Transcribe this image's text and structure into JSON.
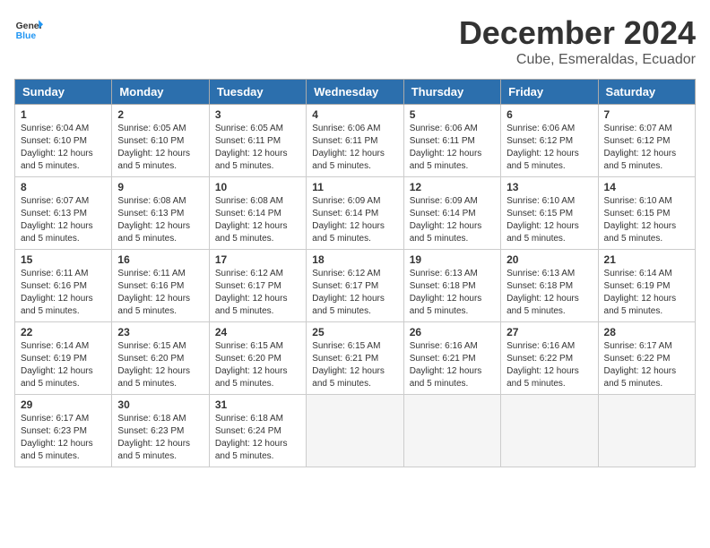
{
  "header": {
    "logo_general": "General",
    "logo_blue": "Blue",
    "month_title": "December 2024",
    "location": "Cube, Esmeraldas, Ecuador"
  },
  "weekdays": [
    "Sunday",
    "Monday",
    "Tuesday",
    "Wednesday",
    "Thursday",
    "Friday",
    "Saturday"
  ],
  "weeks": [
    [
      {
        "day": "1",
        "sunrise": "6:04 AM",
        "sunset": "6:10 PM",
        "daylight": "12 hours and 5 minutes."
      },
      {
        "day": "2",
        "sunrise": "6:05 AM",
        "sunset": "6:10 PM",
        "daylight": "12 hours and 5 minutes."
      },
      {
        "day": "3",
        "sunrise": "6:05 AM",
        "sunset": "6:11 PM",
        "daylight": "12 hours and 5 minutes."
      },
      {
        "day": "4",
        "sunrise": "6:06 AM",
        "sunset": "6:11 PM",
        "daylight": "12 hours and 5 minutes."
      },
      {
        "day": "5",
        "sunrise": "6:06 AM",
        "sunset": "6:11 PM",
        "daylight": "12 hours and 5 minutes."
      },
      {
        "day": "6",
        "sunrise": "6:06 AM",
        "sunset": "6:12 PM",
        "daylight": "12 hours and 5 minutes."
      },
      {
        "day": "7",
        "sunrise": "6:07 AM",
        "sunset": "6:12 PM",
        "daylight": "12 hours and 5 minutes."
      }
    ],
    [
      {
        "day": "8",
        "sunrise": "6:07 AM",
        "sunset": "6:13 PM",
        "daylight": "12 hours and 5 minutes."
      },
      {
        "day": "9",
        "sunrise": "6:08 AM",
        "sunset": "6:13 PM",
        "daylight": "12 hours and 5 minutes."
      },
      {
        "day": "10",
        "sunrise": "6:08 AM",
        "sunset": "6:14 PM",
        "daylight": "12 hours and 5 minutes."
      },
      {
        "day": "11",
        "sunrise": "6:09 AM",
        "sunset": "6:14 PM",
        "daylight": "12 hours and 5 minutes."
      },
      {
        "day": "12",
        "sunrise": "6:09 AM",
        "sunset": "6:14 PM",
        "daylight": "12 hours and 5 minutes."
      },
      {
        "day": "13",
        "sunrise": "6:10 AM",
        "sunset": "6:15 PM",
        "daylight": "12 hours and 5 minutes."
      },
      {
        "day": "14",
        "sunrise": "6:10 AM",
        "sunset": "6:15 PM",
        "daylight": "12 hours and 5 minutes."
      }
    ],
    [
      {
        "day": "15",
        "sunrise": "6:11 AM",
        "sunset": "6:16 PM",
        "daylight": "12 hours and 5 minutes."
      },
      {
        "day": "16",
        "sunrise": "6:11 AM",
        "sunset": "6:16 PM",
        "daylight": "12 hours and 5 minutes."
      },
      {
        "day": "17",
        "sunrise": "6:12 AM",
        "sunset": "6:17 PM",
        "daylight": "12 hours and 5 minutes."
      },
      {
        "day": "18",
        "sunrise": "6:12 AM",
        "sunset": "6:17 PM",
        "daylight": "12 hours and 5 minutes."
      },
      {
        "day": "19",
        "sunrise": "6:13 AM",
        "sunset": "6:18 PM",
        "daylight": "12 hours and 5 minutes."
      },
      {
        "day": "20",
        "sunrise": "6:13 AM",
        "sunset": "6:18 PM",
        "daylight": "12 hours and 5 minutes."
      },
      {
        "day": "21",
        "sunrise": "6:14 AM",
        "sunset": "6:19 PM",
        "daylight": "12 hours and 5 minutes."
      }
    ],
    [
      {
        "day": "22",
        "sunrise": "6:14 AM",
        "sunset": "6:19 PM",
        "daylight": "12 hours and 5 minutes."
      },
      {
        "day": "23",
        "sunrise": "6:15 AM",
        "sunset": "6:20 PM",
        "daylight": "12 hours and 5 minutes."
      },
      {
        "day": "24",
        "sunrise": "6:15 AM",
        "sunset": "6:20 PM",
        "daylight": "12 hours and 5 minutes."
      },
      {
        "day": "25",
        "sunrise": "6:15 AM",
        "sunset": "6:21 PM",
        "daylight": "12 hours and 5 minutes."
      },
      {
        "day": "26",
        "sunrise": "6:16 AM",
        "sunset": "6:21 PM",
        "daylight": "12 hours and 5 minutes."
      },
      {
        "day": "27",
        "sunrise": "6:16 AM",
        "sunset": "6:22 PM",
        "daylight": "12 hours and 5 minutes."
      },
      {
        "day": "28",
        "sunrise": "6:17 AM",
        "sunset": "6:22 PM",
        "daylight": "12 hours and 5 minutes."
      }
    ],
    [
      {
        "day": "29",
        "sunrise": "6:17 AM",
        "sunset": "6:23 PM",
        "daylight": "12 hours and 5 minutes."
      },
      {
        "day": "30",
        "sunrise": "6:18 AM",
        "sunset": "6:23 PM",
        "daylight": "12 hours and 5 minutes."
      },
      {
        "day": "31",
        "sunrise": "6:18 AM",
        "sunset": "6:24 PM",
        "daylight": "12 hours and 5 minutes."
      },
      null,
      null,
      null,
      null
    ]
  ]
}
